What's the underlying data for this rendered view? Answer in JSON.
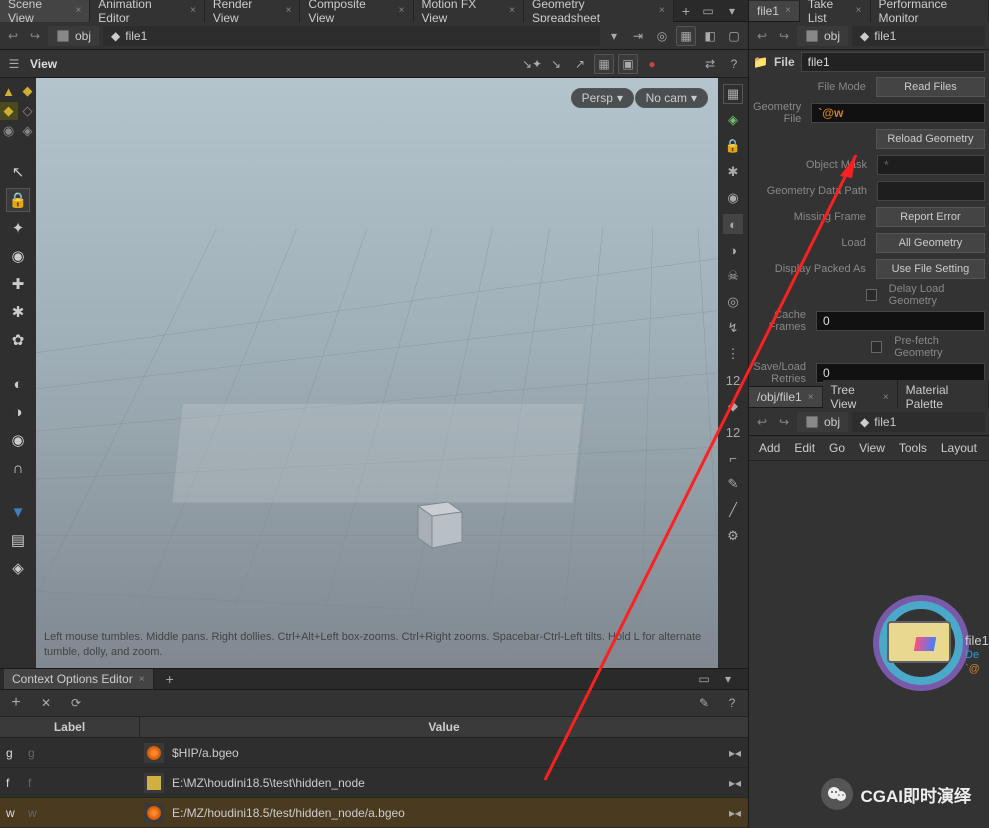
{
  "left_tabs": [
    "Scene View",
    "Animation Editor",
    "Render View",
    "Composite View",
    "Motion FX View",
    "Geometry Spreadsheet"
  ],
  "path_left": {
    "obj": "obj",
    "file": "file1"
  },
  "view": {
    "label": "View",
    "cam1": "Persp",
    "cam2": "No cam"
  },
  "vp_hint": "Left mouse tumbles. Middle pans. Right dollies. Ctrl+Alt+Left box-zooms. Ctrl+Right zooms. Spacebar-Ctrl-Left tilts. Hold L for alternate tumble, dolly, and zoom.",
  "ctx": {
    "tab": "Context Options Editor",
    "col_label": "Label",
    "col_value": "Value",
    "rows": [
      {
        "name": "g",
        "ghost": "g",
        "value": "$HIP/a.bgeo",
        "icon": "swirl"
      },
      {
        "name": "f",
        "ghost": "f",
        "value": "E:\\MZ\\houdini18.5\\test\\hidden_node",
        "icon": "folder"
      },
      {
        "name": "w",
        "ghost": "w",
        "value": "E:/MZ/houdini18.5/test/hidden_node/a.bgeo",
        "icon": "swirl",
        "hl": true
      }
    ]
  },
  "right_tabs1": [
    "file1",
    "Take List",
    "Performance Monitor"
  ],
  "path_right": {
    "obj": "obj",
    "file": "file1"
  },
  "param_file": {
    "label": "File",
    "value": "file1"
  },
  "params": {
    "file_mode": {
      "lbl": "File Mode",
      "btn": "Read Files"
    },
    "geo_file": {
      "lbl": "Geometry File",
      "val": "`@w"
    },
    "reload": {
      "btn": "Reload Geometry"
    },
    "obj_mask": {
      "lbl": "Object Mask",
      "val": "*"
    },
    "data_path": {
      "lbl": "Geometry Data Path",
      "val": ""
    },
    "missing": {
      "lbl": "Missing Frame",
      "btn": "Report Error"
    },
    "load": {
      "lbl": "Load",
      "btn": "All Geometry"
    },
    "packed": {
      "lbl": "Display Packed As",
      "btn": "Use File Setting"
    },
    "delay": {
      "lbl": "Delay Load Geometry"
    },
    "cache": {
      "lbl": "Cache Frames",
      "val": "0"
    },
    "prefetch": {
      "lbl": "Pre-fetch Geometry"
    },
    "retries": {
      "lbl": "Save/Load Retries",
      "val": "0"
    }
  },
  "right_tabs2": [
    "/obj/file1",
    "Tree View",
    "Material Palette"
  ],
  "path_right2": {
    "obj": "obj",
    "file": "file1"
  },
  "menubar": [
    "Add",
    "Edit",
    "Go",
    "View",
    "Tools",
    "Layout"
  ],
  "node": {
    "name": "file1",
    "sub1": "De",
    "sub2": "`@"
  },
  "watermark": "CGAI即时演绎"
}
